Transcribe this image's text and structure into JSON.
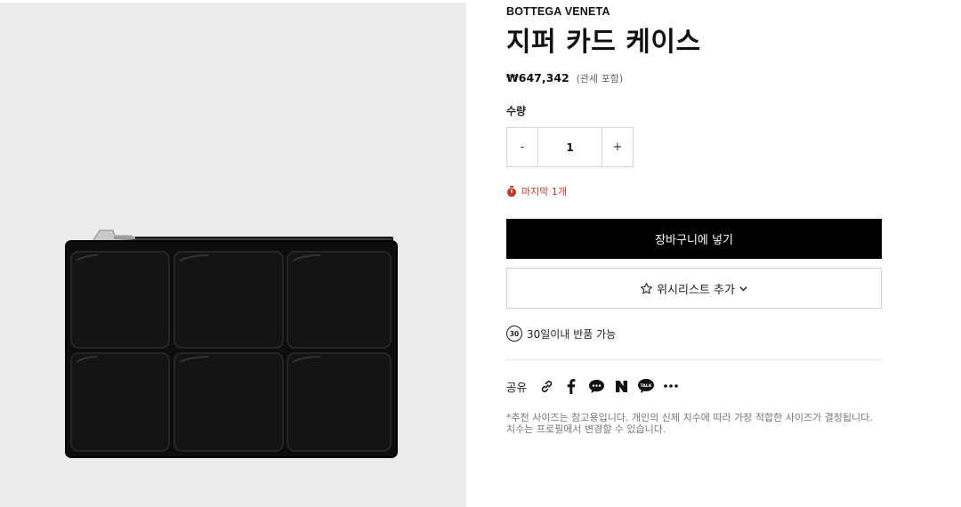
{
  "product": {
    "brand": "BOTTEGA VENETA",
    "title": "지퍼 카드 케이스",
    "price": "₩647,342",
    "price_note": "(관세 포함)",
    "image_icon": "zip-card-case-image"
  },
  "quantity": {
    "label": "수량",
    "decrement": "-",
    "value": "1",
    "increment": "+"
  },
  "stock": {
    "text": "마지막 1개",
    "icon": "stopwatch-icon",
    "color": "#c0392b"
  },
  "actions": {
    "add_to_cart": "장바구니에 넣기",
    "wishlist": "위시리스트 추가"
  },
  "returns": {
    "badge": "30",
    "text": "30일이내 반품 가능"
  },
  "share": {
    "label": "공유",
    "icons": [
      "link-icon",
      "facebook-icon",
      "chat-bubble-icon",
      "naver-icon",
      "kakaotalk-icon",
      "more-icon"
    ],
    "talk_text": "TALK"
  },
  "disclaimer": "*추천 사이즈는 참고용입니다. 개인의 신체 치수에 따라 가장 적합한 사이즈가 결정됩니다. 치수는 프로필에서 변경할 수 있습니다.",
  "colors": {
    "accent": "#000000",
    "image_bg": "#ececec",
    "stock_red": "#c0392b"
  }
}
